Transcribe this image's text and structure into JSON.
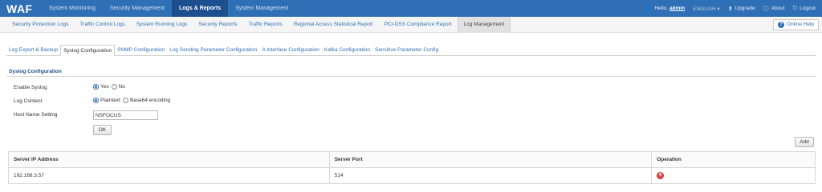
{
  "app": {
    "logo": "WAF"
  },
  "main_nav": {
    "items": [
      {
        "label": "System Monitoring",
        "active": false
      },
      {
        "label": "Security Management",
        "active": false
      },
      {
        "label": "Logs & Reports",
        "active": true
      },
      {
        "label": "System Management",
        "active": false
      }
    ]
  },
  "user_bar": {
    "hello": "Hello,",
    "username": "admin",
    "language": "ENGLISH ▾",
    "upgrade": "Upgrade",
    "about": "About",
    "logout": "Logout"
  },
  "sub_nav": {
    "items": [
      {
        "label": "Security Protection Logs",
        "active": false
      },
      {
        "label": "Traffic Control Logs",
        "active": false
      },
      {
        "label": "System Running Logs",
        "active": false
      },
      {
        "label": "Security Reports",
        "active": false
      },
      {
        "label": "Traffic Reports",
        "active": false
      },
      {
        "label": "Regional Access Statistical Report",
        "active": false
      },
      {
        "label": "PCI-DSS Compliance Report",
        "active": false
      },
      {
        "label": "Log Management",
        "active": true
      }
    ],
    "help": "Online Help"
  },
  "tabs": {
    "items": [
      {
        "label": "Log Export & Backup",
        "active": false
      },
      {
        "label": "Syslog Configuration",
        "active": true
      },
      {
        "label": "SNMP Configuration",
        "active": false
      },
      {
        "label": "Log Sending Parameter Configuration",
        "active": false
      },
      {
        "label": "A Interface Configuration",
        "active": false
      },
      {
        "label": "Kafka Configuration",
        "active": false
      },
      {
        "label": "Sensitive Parameter Config",
        "active": false
      }
    ]
  },
  "syslog": {
    "section_title": "Syslog Configuration",
    "enable_label": "Enable Syslog",
    "enable_options": [
      "Yes",
      "No"
    ],
    "enable_selected": "Yes",
    "content_label": "Log Content",
    "content_options": [
      "Plaintext",
      "Base64 encoding"
    ],
    "content_selected": "Plaintext",
    "host_label": "Host Name Setting",
    "host_value": "NSFOCUS",
    "ok_label": "OK",
    "add_label": "Add"
  },
  "table": {
    "headers": [
      "Server IP Address",
      "Server Port",
      "Operation"
    ],
    "rows": [
      {
        "ip": "192.168.3.57",
        "port": "514"
      }
    ]
  },
  "colors": {
    "topbar": "#2f6fb5",
    "topbar_active": "#1d4f8e",
    "link": "#2f6fb5",
    "delete": "#e04848"
  }
}
